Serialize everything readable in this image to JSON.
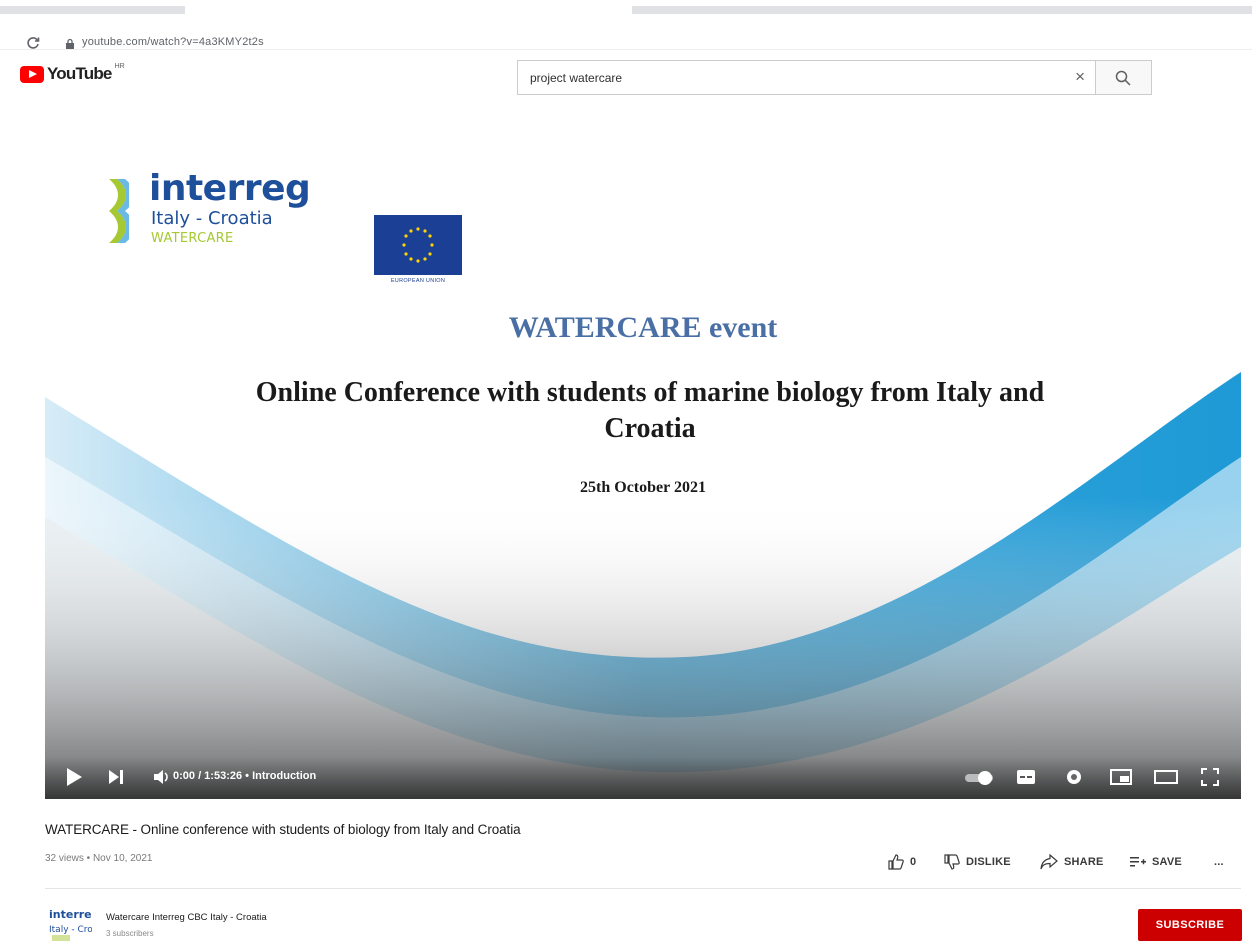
{
  "browser": {
    "url": "youtube.com/watch?v=4a3KMY2t2s"
  },
  "header": {
    "logo_text": "YouTube",
    "region_code": "HR",
    "search_query": "project watercare"
  },
  "video": {
    "slide": {
      "logo_interreg": "interreg",
      "logo_country": "Italy - Croatia",
      "logo_project": "WATERCARE",
      "eu_label": "EUROPEAN UNION",
      "event": "WATERCARE event",
      "title": "Online Conference with students of marine biology from Italy and Croatia",
      "date": "25th October 2021"
    },
    "controls": {
      "time": "0:00 / 1:53:26 • Introduction"
    },
    "title": "WATERCARE - Online conference with students of biology from Italy and Croatia",
    "meta": "32 views • Nov 10, 2021",
    "actions": {
      "like_count": "0",
      "dislike": "DISLIKE",
      "share": "SHARE",
      "save": "SAVE",
      "more": "..."
    }
  },
  "channel": {
    "name": "Watercare Interreg CBC Italy - Croatia",
    "subscribers": "3 subscribers",
    "avatar_text": "interreg\nItaly - Croatia",
    "subscribe": "SUBSCRIBE"
  },
  "colors": {
    "youtube_red": "#ff0000",
    "subscribe_red": "#cc0000",
    "interreg_blue": "#1d4f9a",
    "watercare_green": "#a6c832",
    "wave_blue": "#1e9ad6"
  }
}
